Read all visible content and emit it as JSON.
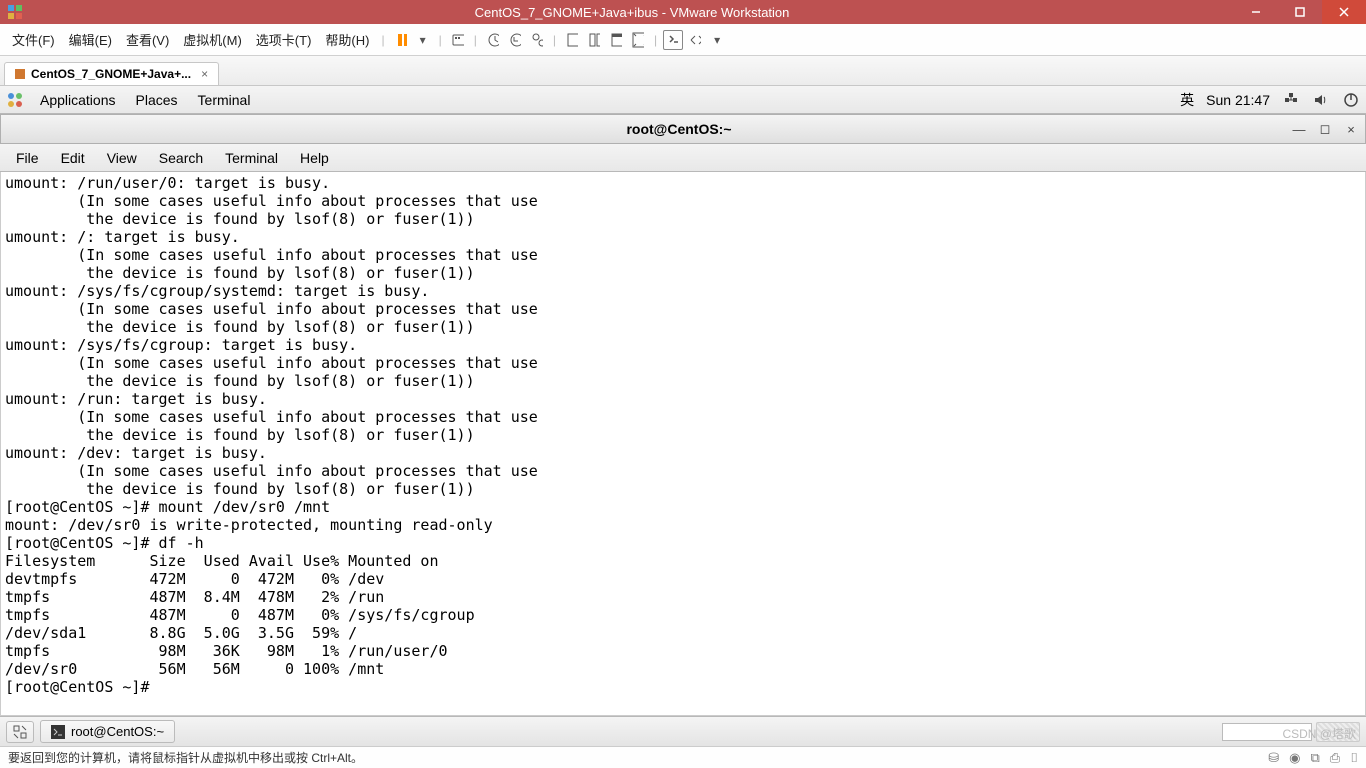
{
  "window": {
    "title": "CentOS_7_GNOME+Java+ibus - VMware Workstation"
  },
  "vmware_menu": {
    "file": "文件(F)",
    "edit": "编辑(E)",
    "view": "查看(V)",
    "vm": "虚拟机(M)",
    "tabs": "选项卡(T)",
    "help": "帮助(H)"
  },
  "vmware_tab": {
    "label": "CentOS_7_GNOME+Java+..."
  },
  "gnome_panel": {
    "applications": "Applications",
    "places": "Places",
    "terminal": "Terminal",
    "input": "英",
    "clock": "Sun 21:47"
  },
  "terminal_window": {
    "title": "root@CentOS:~"
  },
  "terminal_menu": {
    "file": "File",
    "edit": "Edit",
    "view": "View",
    "search": "Search",
    "terminal": "Terminal",
    "help": "Help"
  },
  "terminal_lines": [
    "umount: /run/user/0: target is busy.",
    "        (In some cases useful info about processes that use",
    "         the device is found by lsof(8) or fuser(1))",
    "umount: /: target is busy.",
    "        (In some cases useful info about processes that use",
    "         the device is found by lsof(8) or fuser(1))",
    "umount: /sys/fs/cgroup/systemd: target is busy.",
    "        (In some cases useful info about processes that use",
    "         the device is found by lsof(8) or fuser(1))",
    "umount: /sys/fs/cgroup: target is busy.",
    "        (In some cases useful info about processes that use",
    "         the device is found by lsof(8) or fuser(1))",
    "umount: /run: target is busy.",
    "        (In some cases useful info about processes that use",
    "         the device is found by lsof(8) or fuser(1))",
    "umount: /dev: target is busy.",
    "        (In some cases useful info about processes that use",
    "         the device is found by lsof(8) or fuser(1))",
    "[root@CentOS ~]# mount /dev/sr0 /mnt",
    "mount: /dev/sr0 is write-protected, mounting read-only",
    "[root@CentOS ~]# df -h",
    "Filesystem      Size  Used Avail Use% Mounted on",
    "devtmpfs        472M     0  472M   0% /dev",
    "tmpfs           487M  8.4M  478M   2% /run",
    "tmpfs           487M     0  487M   0% /sys/fs/cgroup",
    "/dev/sda1       8.8G  5.0G  3.5G  59% /",
    "tmpfs            98M   36K   98M   1% /run/user/0",
    "/dev/sr0         56M   56M     0 100% /mnt",
    "[root@CentOS ~]# "
  ],
  "taskbar": {
    "task1": "root@CentOS:~"
  },
  "vm_status": {
    "hint": "要返回到您的计算机，请将鼠标指针从虚拟机中移出或按 Ctrl+Alt。"
  },
  "watermark": "CSDN @塔歌"
}
